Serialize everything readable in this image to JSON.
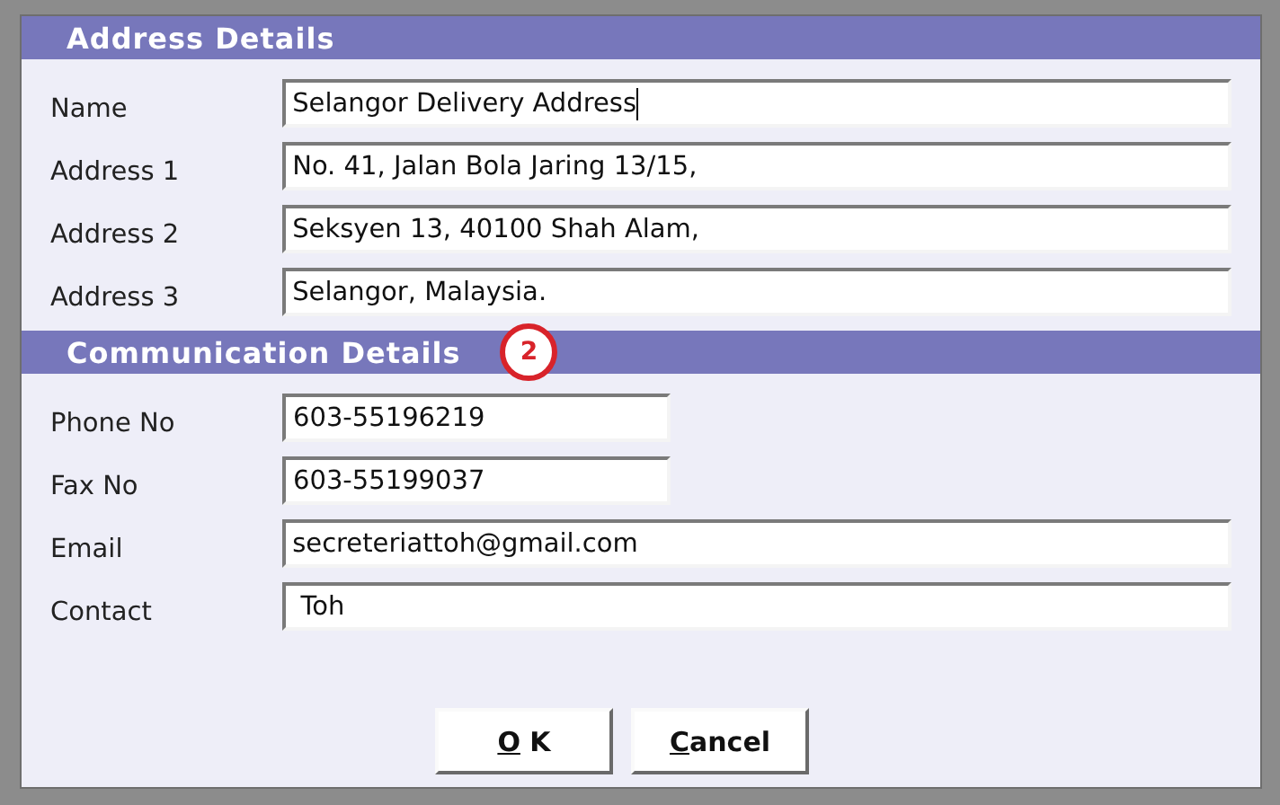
{
  "sections": [
    {
      "title": "Address Details",
      "fields": [
        {
          "label": "Name",
          "value": "Selangor Delivery Address",
          "kind": "wide",
          "focused": true
        },
        {
          "label": "Address 1",
          "value": "No. 41, Jalan Bola Jaring 13/15,",
          "kind": "wide",
          "focused": false
        },
        {
          "label": "Address 2",
          "value": "Seksyen 13, 40100 Shah Alam,",
          "kind": "wide",
          "focused": false
        },
        {
          "label": "Address 3",
          "value": "Selangor, Malaysia.",
          "kind": "wide",
          "focused": false
        }
      ]
    },
    {
      "title": "Communication Details",
      "callout": "2",
      "fields": [
        {
          "label": "Phone No",
          "value": "603-55196219",
          "kind": "short",
          "focused": false
        },
        {
          "label": "Fax No",
          "value": "603-55199037",
          "kind": "short",
          "focused": false
        },
        {
          "label": "Email",
          "value": "secreteriattoh@gmail.com",
          "kind": "wide",
          "focused": false
        },
        {
          "label": "Contact",
          "value": " Toh",
          "kind": "wide",
          "focused": false
        }
      ]
    }
  ],
  "buttons": [
    {
      "label": "O K",
      "mnemonic_first": true
    },
    {
      "label": "Cancel",
      "mnemonic_first": true
    }
  ]
}
